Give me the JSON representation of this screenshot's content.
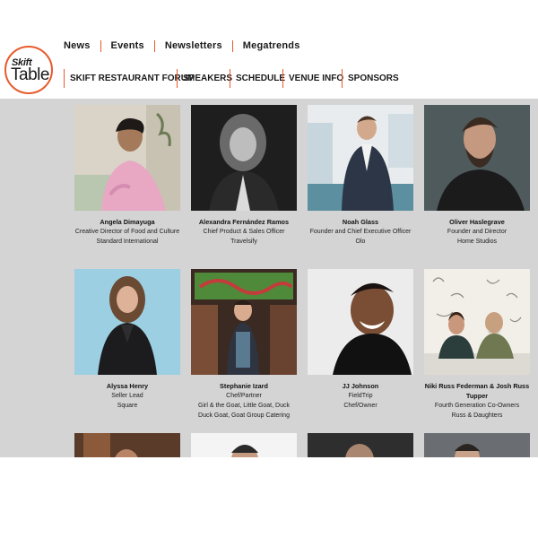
{
  "logo": {
    "line1": "Skift",
    "line2": "Table"
  },
  "topnav": [
    "News",
    "Events",
    "Newsletters",
    "Megatrends"
  ],
  "subnav": [
    "SKIFT RESTAURANT FORUM",
    "SPEAKERS",
    "SCHEDULE",
    "VENUE INFO",
    "SPONSORS"
  ],
  "speakers": [
    {
      "name": "Angela Dimayuga",
      "role": "Creative Director of Food and Culture",
      "company": "Standard International"
    },
    {
      "name": "Alexandra Fernández Ramos",
      "role": "Chief Product & Sales Officer",
      "company": "Travelsify"
    },
    {
      "name": "Noah Glass",
      "role": "Founder and Chief Executive Officer",
      "company": "Olo"
    },
    {
      "name": "Oliver Haslegrave",
      "role": "Founder and Director",
      "company": "Home Studios"
    },
    {
      "name": "Alyssa Henry",
      "role": "Seller Lead",
      "company": "Square"
    },
    {
      "name": "Stephanie Izard",
      "role": "Chef/Partner",
      "company": "Girl & the Goat, Little Goat, Duck Duck Goat, Goat Group Catering"
    },
    {
      "name": "JJ Johnson",
      "role": "FieldTrip",
      "company": "Chef/Owner"
    },
    {
      "name": "Niki Russ Federman & Josh Russ Tupper",
      "role": "Fourth Generation Co-Owners",
      "company": "Russ & Daughters"
    }
  ],
  "colors": {
    "accent": "#e85a2b",
    "content_bg": "#d4d4d4"
  }
}
